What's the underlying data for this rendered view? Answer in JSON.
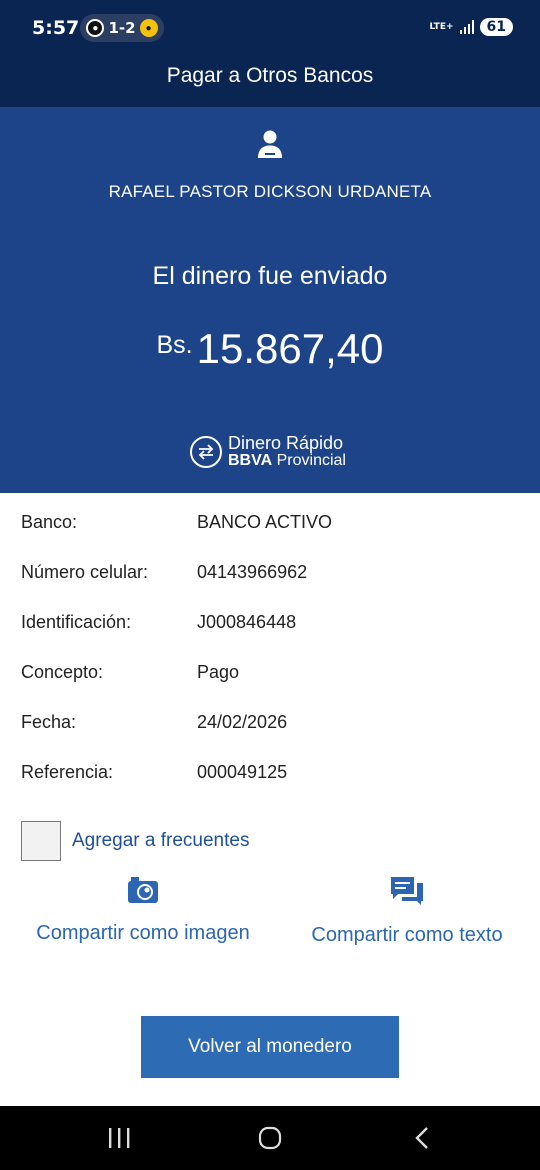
{
  "status_bar": {
    "time": "5:57",
    "score": "1-2",
    "network": "LTE+",
    "battery": "61"
  },
  "header": {
    "title": "Pagar a Otros Bancos"
  },
  "receipt": {
    "recipient": "RAFAEL PASTOR DICKSON URDANETA",
    "message": "El dinero fue enviado",
    "currency": "Bs.",
    "amount": "15.867,40",
    "brand_line1": "Dinero Rápido",
    "brand_bbva": "BBVA",
    "brand_provincial": "Provincial"
  },
  "details": [
    {
      "label": "Banco:",
      "value": "BANCO ACTIVO"
    },
    {
      "label": "Número celular:",
      "value": "04143966962"
    },
    {
      "label": "Identificación:",
      "value": "J000846448"
    },
    {
      "label": "Concepto:",
      "value": "Pago"
    },
    {
      "label": "Fecha:",
      "value": "24/02/2026"
    },
    {
      "label": "Referencia:",
      "value": "000049125"
    }
  ],
  "frequent": {
    "label": "Agregar a frecuentes",
    "checked": false
  },
  "share": {
    "image_label": "Compartir como imagen",
    "text_label": "Compartir como texto",
    "image_icon": "camera-icon",
    "text_icon": "chat-bubbles-icon"
  },
  "actions": {
    "back_to_wallet": "Volver al monedero"
  },
  "colors": {
    "top_bar": "#0a2552",
    "hero": "#1d4488",
    "link": "#2c65b2",
    "button": "#2d6bb5"
  }
}
